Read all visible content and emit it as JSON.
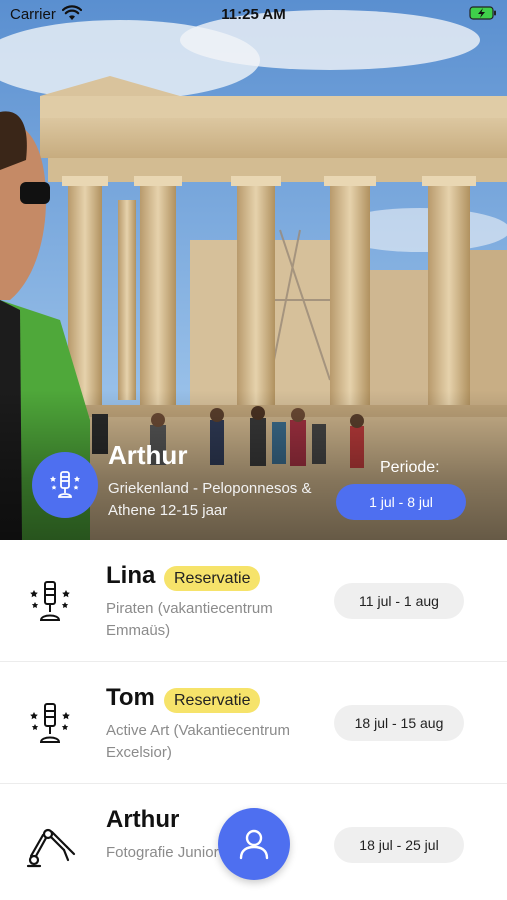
{
  "status_bar": {
    "carrier": "Carrier",
    "time": "11:25 AM",
    "icons": [
      "wifi-icon",
      "battery-charging-icon"
    ]
  },
  "hero": {
    "name": "Arthur",
    "description": "Griekenland - Peloponnesos & Athene 12-15 jaar",
    "period_label": "Periode:",
    "period_value": "1 jul - 8 jul",
    "avatar_icon": "microphone-star-icon",
    "accent_color": "#4e6ff0"
  },
  "list": {
    "items": [
      {
        "name": "Lina",
        "badge": "Reservatie",
        "description": "Piraten (vakantiecentrum Emmaüs)",
        "dates": "11 jul - 1 aug",
        "icon": "microphone-star-icon"
      },
      {
        "name": "Tom",
        "badge": "Reservatie",
        "description": "Active Art (Vakantiecentrum Excelsior)",
        "dates": "18 jul - 15 aug",
        "icon": "microphone-star-icon"
      },
      {
        "name": "Arthur",
        "badge": "",
        "description": "Fotografie Junior 14 jaar",
        "dates": "18 jul - 25 jul",
        "icon": "robot-arm-icon"
      }
    ]
  },
  "fab": {
    "icon": "user-icon"
  },
  "colors": {
    "accent": "#4e6ff0",
    "badge": "#f6e36a",
    "date_pill": "#efefef"
  }
}
